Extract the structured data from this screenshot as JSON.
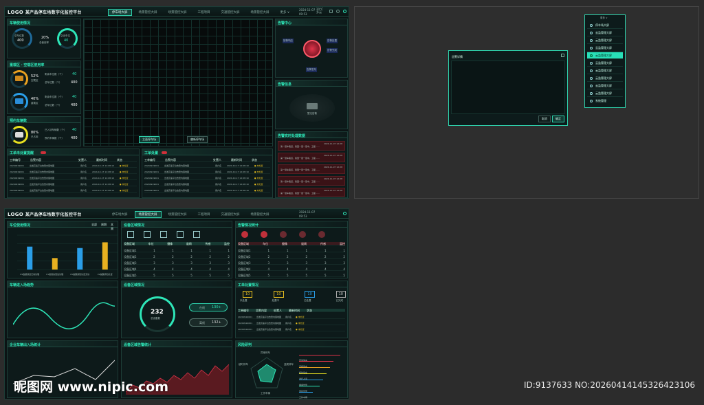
{
  "top_screen": {
    "logo": "LOGO",
    "title": "某产品停车场数字化监控平台",
    "tabs": [
      "停车场大屏",
      "场景管控大屏",
      "场景管控大屏",
      "工程项目",
      "交通管控大屏",
      "场景管控大屏",
      "更多 ∨"
    ],
    "date": "2024-11-07",
    "time": "09:53",
    "weather": "20°C 多云",
    "parking_usage": {
      "title": "车辆使用情况",
      "left_label": "总车位数",
      "left_value": "400",
      "center": "20%",
      "center_sub": "总使用率",
      "right_label": "空余车位",
      "right_value": "40"
    },
    "zone_title": "重载区 · 空载区使用率",
    "zones": [
      {
        "pct": "52%",
        "label": "空载区",
        "r1": "剩余车位数（个）",
        "r1v": "40",
        "r2": "总车位数（个）",
        "r2v": "400"
      },
      {
        "pct": "40%",
        "label": "重载区",
        "r1": "剩余车位数（个）",
        "r1v": "40",
        "r2": "总车位数（个）",
        "r2v": "400"
      }
    ],
    "reserve_title": "预约车辆数",
    "reserve": {
      "pct": "80%",
      "label": "已占用",
      "r1": "已入场车辆数（个）",
      "r1v": "40",
      "r2": "预约车辆数（个）",
      "r2v": "400"
    },
    "map_btn1": "立面停车场",
    "map_btn2": "偏新停车场",
    "alarm_center": "告警中心",
    "alarm_nodes": [
      "接警响应",
      "告警处置",
      "告警完成",
      "告警发布"
    ],
    "alarm_info": "告警信息",
    "alarm_empty": "暂无告警",
    "alarm_list_title": "告警实时处理数据",
    "alarm_item": "第一层车路道，我国一层一层中，卫星……",
    "alarm_time": "2024-11-07 12:28",
    "order_title": "工单未处置提醒",
    "order_title2": "工单处置",
    "cols": [
      "工单编号",
      "告警内容",
      "处置人",
      "最新时间",
      "状态"
    ],
    "row_id": "20240919001",
    "row_text": "出发高速平台告警内容地图",
    "row_person": "用户名",
    "row_time": "2024-10-17 12:08:10",
    "row_state": "● 未处置"
  },
  "dialog": {
    "title": "告警详情",
    "btn_cancel": "取消",
    "btn_ok": "确定"
  },
  "menu": {
    "head": "更多 ∨",
    "items": [
      "停车场大屏",
      "云监管理大屏",
      "云监管理大屏",
      "云监管理大屏",
      "云监管理大屏",
      "云监管理大屏",
      "云监管理大屏",
      "云监管理大屏",
      "云监管理大屏",
      "云监管理大屏",
      "系统管理"
    ],
    "active_index": 4
  },
  "bottom_screen": {
    "logo": "LOGO",
    "title": "某产品停车场数字化监控平台",
    "tabs": [
      "停车场大屏",
      "场景管控大屏",
      "场景管控大屏",
      "工程项目",
      "交通管控大屏",
      "场景管控大屏"
    ],
    "p1": "车位使用情况",
    "p2": "设备区域情况",
    "p3": "告警情况统计",
    "p4": "车辆进入场趋势",
    "p5": "设备区域情况",
    "p6": "工单处置情况",
    "p7": "企业车辆出入场统计",
    "p8": "设备区域告警统计",
    "p9": "风险研判",
    "filters": [
      "全部",
      "周期",
      "本周"
    ],
    "gauge_value": "232",
    "gauge_label": "总设备数",
    "online": "在线",
    "online_v": "130+",
    "offline": "离线",
    "offline_v": "132+",
    "order_counts": [
      "10",
      "10",
      "10",
      "10"
    ],
    "order_states": [
      "未处置",
      "处置中",
      "已处置",
      "已完成"
    ],
    "dev_cols": [
      "设备区域",
      "车位",
      "摄像",
      "道闸",
      "传感",
      "监控"
    ],
    "dev_rows": [
      [
        "设备区域1",
        "1",
        "1",
        "1",
        "1",
        "1"
      ],
      [
        "设备区域2",
        "2",
        "2",
        "2",
        "2",
        "2"
      ],
      [
        "设备区域3",
        "3",
        "3",
        "3",
        "3",
        "3"
      ],
      [
        "设备区域4",
        "4",
        "4",
        "4",
        "4",
        "4"
      ],
      [
        "设备区域5",
        "5",
        "5",
        "5",
        "5",
        "5"
      ]
    ],
    "risk_labels": [
      "异常停车",
      "违规停车",
      "超时停车",
      "逆行占道",
      "工作车辆"
    ],
    "risk_bars": [
      "异常停车",
      "违规停车",
      "超时停车",
      "逆行占道",
      "拥堵告警",
      "离线告警",
      "工作车辆"
    ],
    "legend": [
      "总数",
      "车辆",
      "车辆"
    ]
  },
  "chart_data": {
    "type": "bar",
    "categories": [
      "PS数据通道无效处理",
      "P1级别的警告处理",
      "P5提醒通知处置无效",
      "P2提醒通知处置"
    ],
    "series": [
      {
        "name": "总数",
        "values": [
          80,
          40,
          75,
          95
        ]
      }
    ],
    "ylim": [
      0,
      120
    ]
  },
  "watermark": {
    "site": "昵图网 www.nipic.com",
    "id": "ID:9137633 NO:20260414145326423106"
  },
  "colors": {
    "accent": "#2ee6b8",
    "alarm": "#e0334a",
    "bg": "#0b1314"
  }
}
